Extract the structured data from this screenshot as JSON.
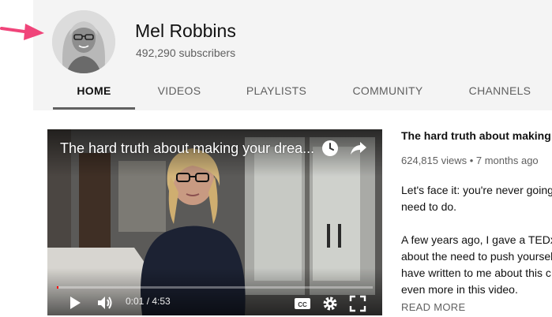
{
  "channel": {
    "name": "Mel Robbins",
    "subscribers": "492,290 subscribers"
  },
  "tabs": [
    {
      "label": "HOME",
      "active": true
    },
    {
      "label": "VIDEOS",
      "active": false
    },
    {
      "label": "PLAYLISTS",
      "active": false
    },
    {
      "label": "COMMUNITY",
      "active": false
    },
    {
      "label": "CHANNELS",
      "active": false
    }
  ],
  "player": {
    "overlay_title": "The hard truth about making your drea...",
    "current_time": "0:01",
    "duration": "4:53",
    "time_readout": "0:01 / 4:53",
    "progress_fraction": 0.004
  },
  "featured": {
    "title": "The hard truth about making yo",
    "meta": "624,815 views • 7 months ago",
    "description_lines": [
      "Let's face it: you're never going",
      "need to do.",
      "",
      "A few years ago, I gave a TEDx",
      "about the need to push yoursel",
      "have written to me about this c",
      "even more in this video."
    ],
    "read_more": "READ MORE"
  },
  "colors": {
    "header_background": "#f4f4f4",
    "active_tab_underline": "#606060",
    "pointer_arrow": "#f0457a",
    "progress_red": "#ff0000"
  },
  "icons": {
    "pointer": "pink-arrow-icon",
    "watch_later": "clock-icon",
    "share": "share-arrow-icon",
    "play": "play-icon",
    "volume": "volume-icon",
    "captions": "cc-icon",
    "settings": "gear-icon",
    "fullscreen": "fullscreen-icon"
  }
}
